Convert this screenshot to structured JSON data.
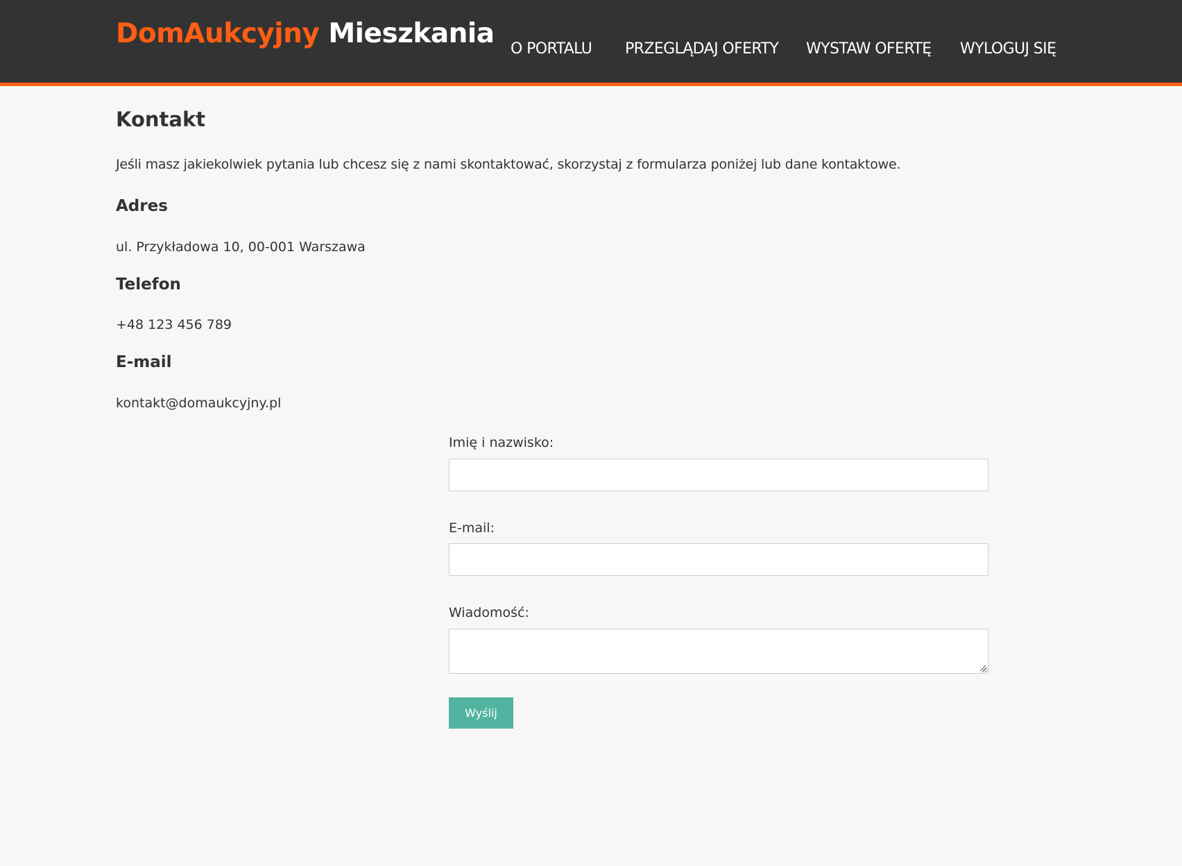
{
  "header": {
    "brand": "DomAukcyjny",
    "section": "Mieszkania",
    "nav": [
      "O PORTALU",
      "PRZEGLĄDAJ OFERTY",
      "WYSTAW OFERTĘ",
      "WYLOGUJ SIĘ"
    ]
  },
  "colors": {
    "accent": "#ff5e14",
    "header_bg": "#333333",
    "button_bg": "#52b3a0",
    "page_bg": "#f7f7f7"
  },
  "contact": {
    "title": "Kontakt",
    "intro": "Jeśli masz jakiekolwiek pytania lub chcesz się z nami skontaktować, skorzystaj z formularza poniżej lub dane kontaktowe.",
    "address_heading": "Adres",
    "address": "ul. Przykładowa 10, 00-001 Warszawa",
    "phone_heading": "Telefon",
    "phone": "+48 123 456 789",
    "email_heading": "E-mail",
    "email": "kontakt@domaukcyjny.pl"
  },
  "form": {
    "name_label": "Imię i nazwisko:",
    "name_value": "",
    "email_label": "E-mail:",
    "email_value": "",
    "message_label": "Wiadomość:",
    "message_value": "",
    "submit_label": "Wyślij"
  }
}
